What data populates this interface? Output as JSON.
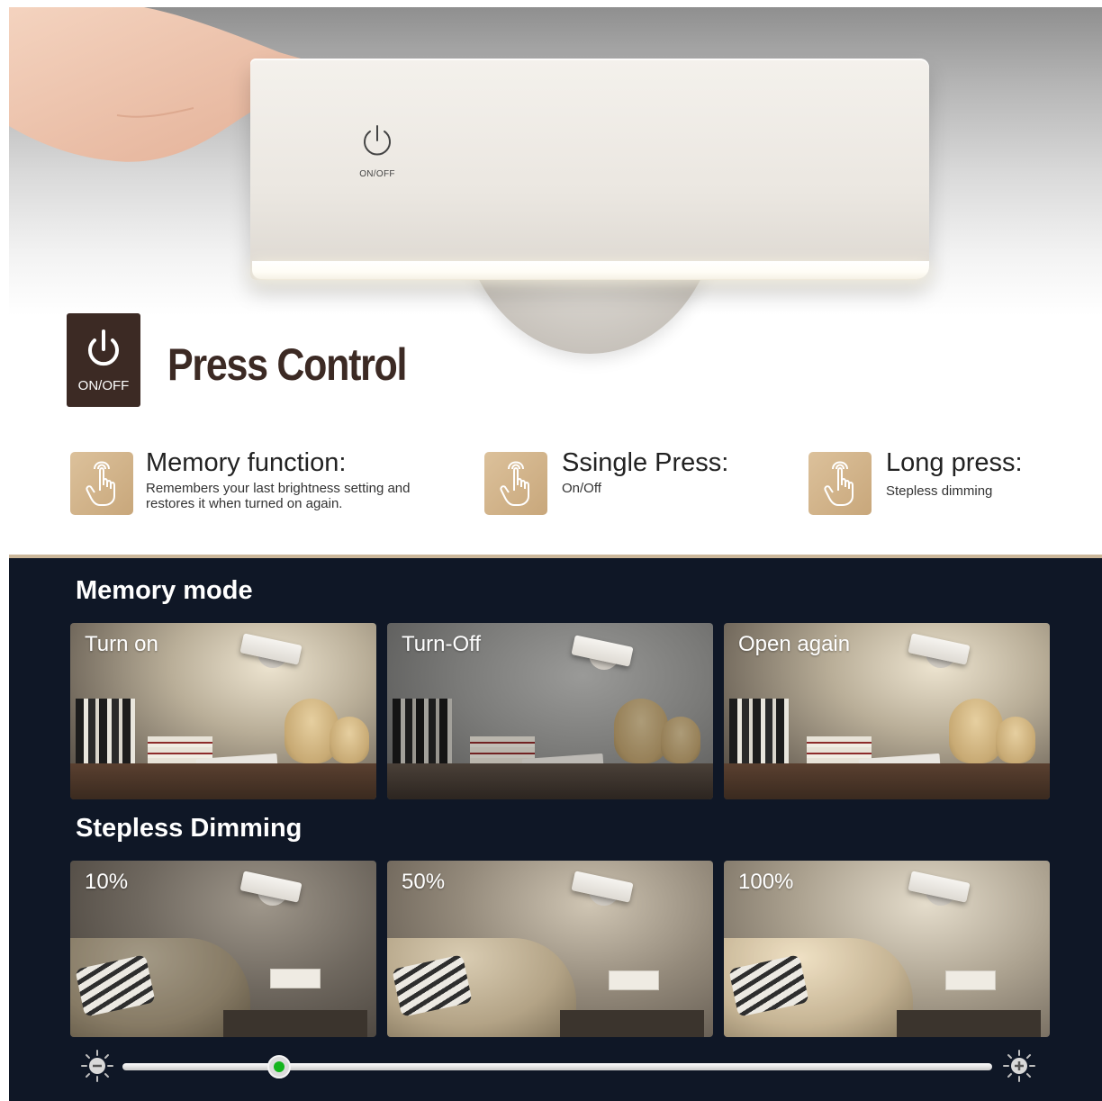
{
  "lamp": {
    "power_label": "ON/OFF"
  },
  "header": {
    "badge_label": "ON/OFF",
    "title": "Press Control"
  },
  "features": [
    {
      "title": "Memory function:",
      "desc_lines": [
        "Remembers your last brightness setting and",
        "restores it when turned on again."
      ],
      "icon": "touch-hand-icon"
    },
    {
      "title": "Ssingle Press:",
      "desc_lines": [
        "On/Off"
      ],
      "icon": "touch-hand-icon"
    },
    {
      "title": "Long press:",
      "desc_lines": [
        "Stepless dimming"
      ],
      "icon": "touch-hand-icon"
    }
  ],
  "memory_mode": {
    "heading": "Memory mode",
    "photos": [
      {
        "label": "Turn on"
      },
      {
        "label": "Turn-Off"
      },
      {
        "label": "Open again"
      }
    ]
  },
  "dimming": {
    "heading": "Stepless Dimming",
    "photos": [
      {
        "label": "10%"
      },
      {
        "label": "50%"
      },
      {
        "label": "100%"
      }
    ],
    "slider": {
      "value": 0.18,
      "minus_icon": "sun-minus-icon",
      "plus_icon": "sun-plus-icon",
      "knob_color": "#14b51d"
    }
  },
  "colors": {
    "brand_dark": "#3c2a24",
    "gold": "#c8a77b",
    "panel": "#0f1726"
  }
}
